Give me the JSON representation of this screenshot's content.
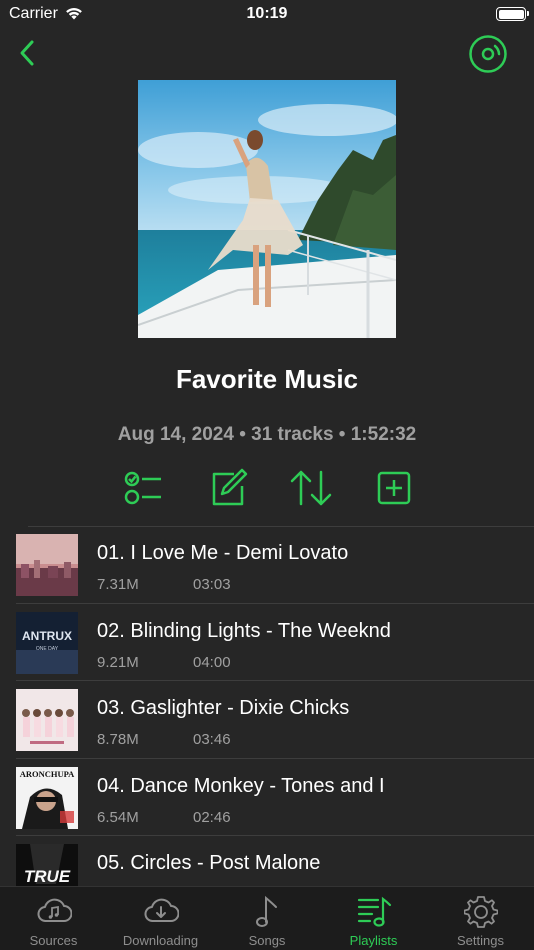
{
  "status": {
    "carrier": "Carrier",
    "time": "10:19"
  },
  "playlist": {
    "title": "Favorite Music",
    "meta": "Aug 14, 2024 • 31 tracks • 1:52:32"
  },
  "icons": {
    "back": "chevron-left-icon",
    "disc": "disc-icon",
    "select": "checklist-icon",
    "edit": "edit-icon",
    "sort": "sort-icon",
    "add": "add-icon"
  },
  "colors": {
    "accent": "#2ecc56",
    "background": "#262626",
    "tabbar": "#1c1c1c",
    "secondary_text": "#a0a0a0"
  },
  "songs": [
    {
      "title": "01. I Love Me - Demi Lovato",
      "size": "7.31M",
      "duration": "03:03"
    },
    {
      "title": "02. Blinding Lights - The Weeknd",
      "size": "9.21M",
      "duration": "04:00"
    },
    {
      "title": "03. Gaslighter - Dixie Chicks",
      "size": "8.78M",
      "duration": "03:46"
    },
    {
      "title": "04. Dance Monkey - Tones and I",
      "size": "6.54M",
      "duration": "02:46"
    },
    {
      "title": "05. Circles - Post Malone",
      "size": "",
      "duration": ""
    }
  ],
  "thumb_text": {
    "t2": "ANTRUX",
    "t2sub": "ONE DAY",
    "t4": "ARONCHUPA",
    "t5": "TRUE"
  },
  "tabs": [
    {
      "label": "Sources"
    },
    {
      "label": "Downloading"
    },
    {
      "label": "Songs"
    },
    {
      "label": "Playlists"
    },
    {
      "label": "Settings"
    }
  ]
}
